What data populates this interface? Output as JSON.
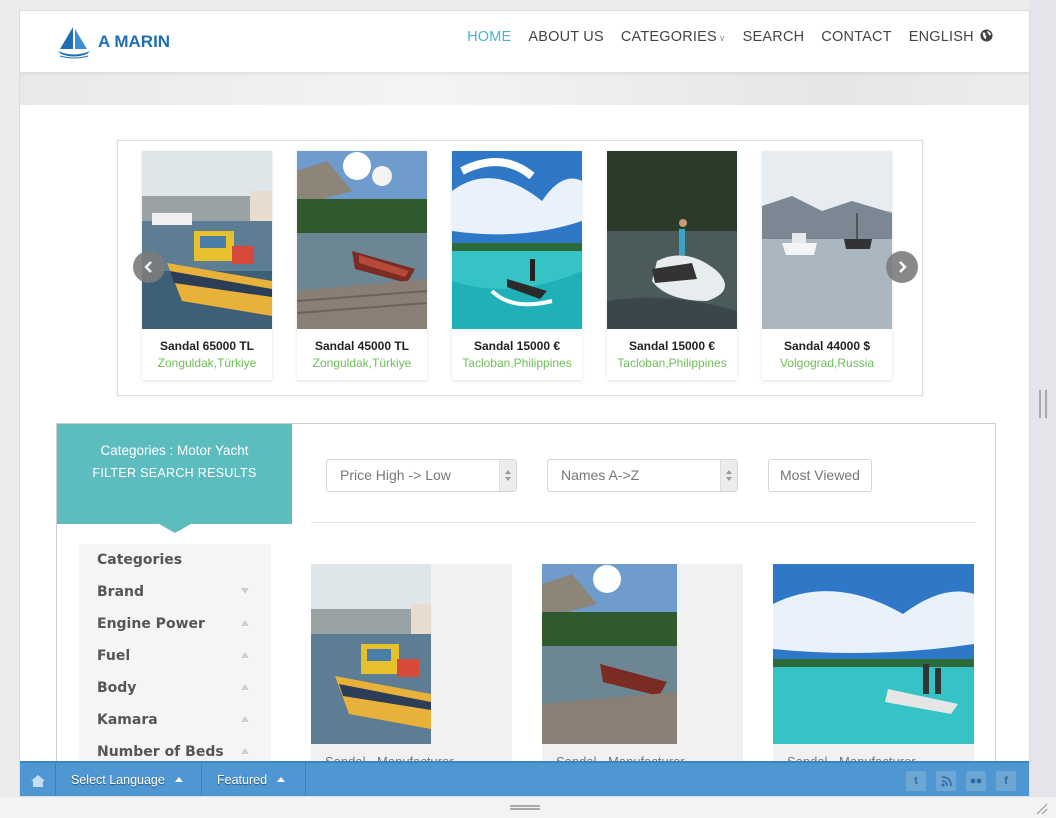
{
  "brand": {
    "name": "A MARIN"
  },
  "nav": [
    {
      "label": "HOME",
      "active": true
    },
    {
      "label": "ABOUT US"
    },
    {
      "label": "CATEGORIES"
    },
    {
      "label": "SEARCH"
    },
    {
      "label": "CONTACT"
    },
    {
      "label": "ENGLISH"
    }
  ],
  "carousel": [
    {
      "title": "Sandal 65000 TL",
      "location": "Zonguldak,Türkiye",
      "scene": "harbor-yellow-boat"
    },
    {
      "title": "Sandal 45000 TL",
      "location": "Zonguldak,Türkiye",
      "scene": "lake-red-boat"
    },
    {
      "title": "Sandal 15000 €",
      "location": "Tacloban,Philippines",
      "scene": "jetski-turquoise"
    },
    {
      "title": "Sandal 15000 €",
      "location": "Tacloban,Philippines",
      "scene": "jetski-dark"
    },
    {
      "title": "Sandal 44000 $",
      "location": "Volgograd,Russia",
      "scene": "fjord-boats"
    }
  ],
  "sidebar": {
    "category_line": "Categories : Motor Yacht",
    "heading": "FILTER SEARCH RESULTS",
    "filters": [
      {
        "label": "Categories",
        "caret": "none"
      },
      {
        "label": "Brand",
        "caret": "down"
      },
      {
        "label": "Engine Power",
        "caret": "up"
      },
      {
        "label": "Fuel",
        "caret": "up"
      },
      {
        "label": "Body",
        "caret": "up"
      },
      {
        "label": "Kamara",
        "caret": "up"
      },
      {
        "label": "Number of Beds",
        "caret": "up"
      }
    ]
  },
  "sort": {
    "price": "Price High -> Low",
    "name": "Names A->Z",
    "most_viewed": "Most Viewed"
  },
  "results": [
    {
      "caption": "Sandal - Manufacturer",
      "scene": "harbor-yellow-boat"
    },
    {
      "caption": "Sandal - Manufacturer",
      "scene": "lake-red-boat"
    },
    {
      "caption": "Sandal - Manufacturer",
      "scene": "jetski-turquoise"
    }
  ],
  "toolbar": {
    "language": "Select Language",
    "featured": "Featured",
    "social": [
      "twitter-icon",
      "rss-icon",
      "flickr-icon",
      "facebook-icon"
    ]
  },
  "colors": {
    "accent": "#5dbcbd",
    "nav_active": "#4fb3c9",
    "location": "#6cbf57",
    "toolbar": "#4f97d2",
    "brand": "#1f6fb5"
  }
}
